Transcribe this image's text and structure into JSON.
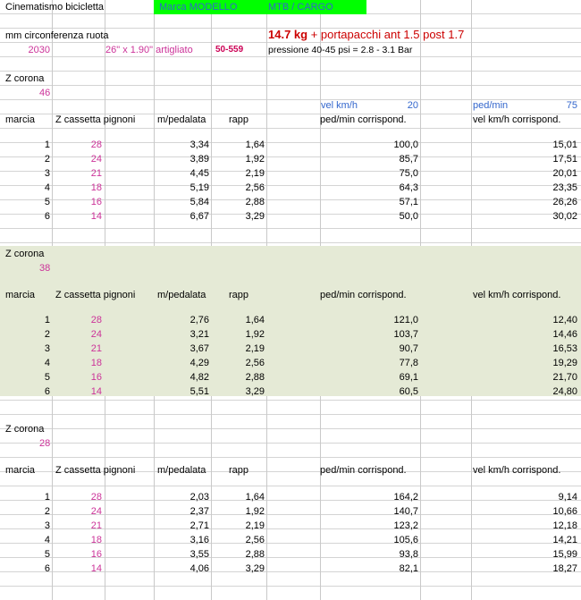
{
  "sheet": {
    "title": "Cinematismo bicicletta",
    "brand_label": "Marca MODELLO",
    "brand_value": "MTB / CARGO",
    "weight_bold": "14.7 kg",
    "weight_rest": " + portapacchi ant 1.5   post 1.7",
    "circ_label": "mm  circonferenza ruota",
    "circ_value": "2030",
    "tire_size": "26\" x 1.90\" artigliato",
    "etrto": "50-559",
    "pressure": "pressione 40-45 psi = 2.8 - 3.1 Bar",
    "vel_label": "vel  km/h",
    "vel_value": "20",
    "ped_label": "ped/min",
    "ped_value": "75",
    "colors": {
      "green_header": "#00ff00",
      "band": "#e5ead6",
      "pink": "#cc3399",
      "blue": "#3366cc",
      "red": "#cc0000"
    }
  },
  "headers": {
    "z_corona": "Z corona",
    "marcia": "marcia",
    "cassetta": "Z cassetta pignoni",
    "m_ped": "m/pedalata",
    "rapp": "rapp",
    "ped_corr": "ped/min corrispond.",
    "vel_corr": "vel  km/h corrispond."
  },
  "blocks": [
    {
      "corona": "46",
      "rows": [
        {
          "marcia": "1",
          "z": "28",
          "m": "3,34",
          "rapp": "1,64",
          "ped": "100,0",
          "vel": "15,01"
        },
        {
          "marcia": "2",
          "z": "24",
          "m": "3,89",
          "rapp": "1,92",
          "ped": "85,7",
          "vel": "17,51"
        },
        {
          "marcia": "3",
          "z": "21",
          "m": "4,45",
          "rapp": "2,19",
          "ped": "75,0",
          "vel": "20,01"
        },
        {
          "marcia": "4",
          "z": "18",
          "m": "5,19",
          "rapp": "2,56",
          "ped": "64,3",
          "vel": "23,35"
        },
        {
          "marcia": "5",
          "z": "16",
          "m": "5,84",
          "rapp": "2,88",
          "ped": "57,1",
          "vel": "26,26"
        },
        {
          "marcia": "6",
          "z": "14",
          "m": "6,67",
          "rapp": "3,29",
          "ped": "50,0",
          "vel": "30,02"
        }
      ]
    },
    {
      "corona": "38",
      "rows": [
        {
          "marcia": "1",
          "z": "28",
          "m": "2,76",
          "rapp": "1,64",
          "ped": "121,0",
          "vel": "12,40"
        },
        {
          "marcia": "2",
          "z": "24",
          "m": "3,21",
          "rapp": "1,92",
          "ped": "103,7",
          "vel": "14,46"
        },
        {
          "marcia": "3",
          "z": "21",
          "m": "3,67",
          "rapp": "2,19",
          "ped": "90,7",
          "vel": "16,53"
        },
        {
          "marcia": "4",
          "z": "18",
          "m": "4,29",
          "rapp": "2,56",
          "ped": "77,8",
          "vel": "19,29"
        },
        {
          "marcia": "5",
          "z": "16",
          "m": "4,82",
          "rapp": "2,88",
          "ped": "69,1",
          "vel": "21,70"
        },
        {
          "marcia": "6",
          "z": "14",
          "m": "5,51",
          "rapp": "3,29",
          "ped": "60,5",
          "vel": "24,80"
        }
      ]
    },
    {
      "corona": "28",
      "rows": [
        {
          "marcia": "1",
          "z": "28",
          "m": "2,03",
          "rapp": "1,64",
          "ped": "164,2",
          "vel": "9,14"
        },
        {
          "marcia": "2",
          "z": "24",
          "m": "2,37",
          "rapp": "1,92",
          "ped": "140,7",
          "vel": "10,66"
        },
        {
          "marcia": "3",
          "z": "21",
          "m": "2,71",
          "rapp": "2,19",
          "ped": "123,2",
          "vel": "12,18"
        },
        {
          "marcia": "4",
          "z": "18",
          "m": "3,16",
          "rapp": "2,56",
          "ped": "105,6",
          "vel": "14,21"
        },
        {
          "marcia": "5",
          "z": "16",
          "m": "3,55",
          "rapp": "2,88",
          "ped": "93,8",
          "vel": "15,99"
        },
        {
          "marcia": "6",
          "z": "14",
          "m": "4,06",
          "rapp": "3,29",
          "ped": "82,1",
          "vel": "18,27"
        }
      ]
    }
  ]
}
